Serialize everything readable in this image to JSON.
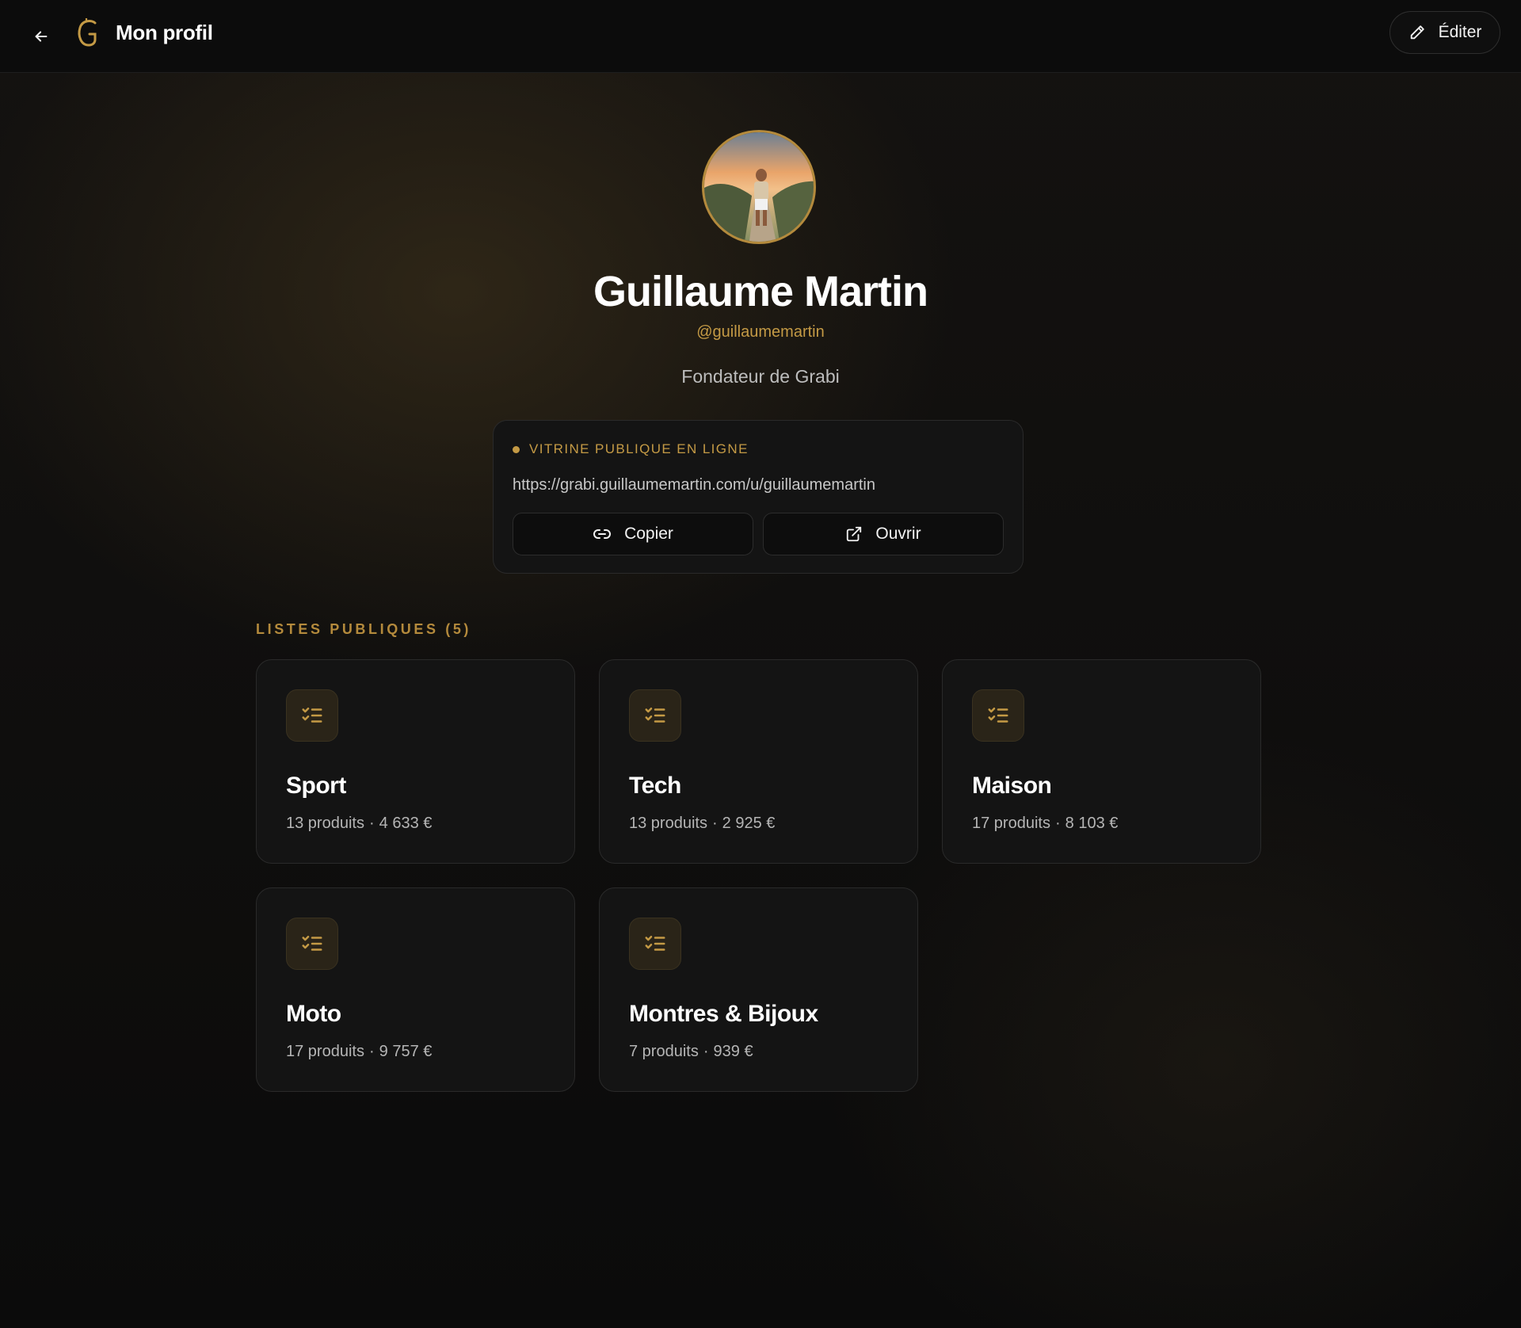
{
  "header": {
    "title": "Mon profil",
    "edit_label": "Éditer",
    "back_icon": "arrow-left-icon",
    "logo_letter": "G"
  },
  "profile": {
    "name": "Guillaume Martin",
    "handle": "@guillaumemartin",
    "bio": "Fondateur de Grabi"
  },
  "vitrine": {
    "status": "VITRINE PUBLIQUE EN LIGNE",
    "url": "https://grabi.guillaumemartin.com/u/guillaumemartin",
    "copy_label": "Copier",
    "open_label": "Ouvrir"
  },
  "lists": {
    "title": "LISTES PUBLIQUES (5)",
    "items": [
      {
        "name": "Sport",
        "products": "13 produits",
        "total": "4 633 €"
      },
      {
        "name": "Tech",
        "products": "13 produits",
        "total": "2 925 €"
      },
      {
        "name": "Maison",
        "products": "17 produits",
        "total": "8 103 €"
      },
      {
        "name": "Moto",
        "products": "17 produits",
        "total": "9 757 €"
      },
      {
        "name": "Montres & Bijoux",
        "products": "7 produits",
        "total": "939 €"
      }
    ],
    "separator": "·"
  },
  "colors": {
    "accent": "#c49a45",
    "background": "#0c0c0c",
    "card": "#141414"
  }
}
